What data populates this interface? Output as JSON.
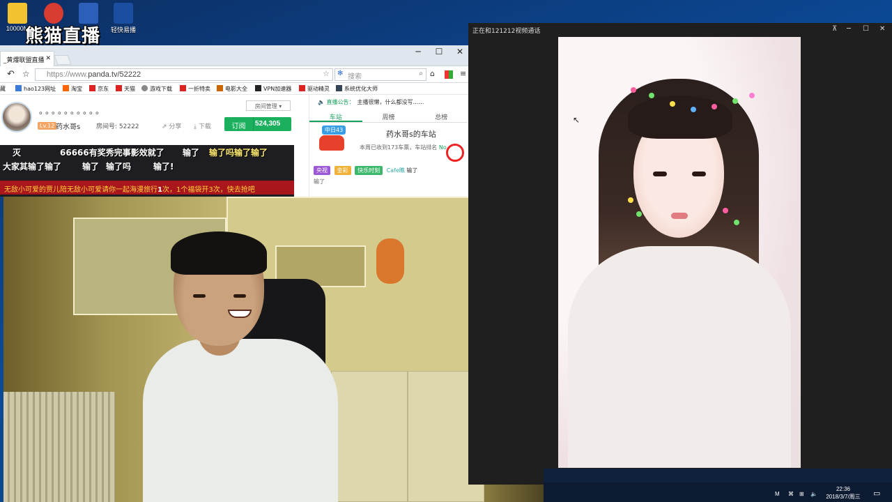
{
  "desktop": {
    "icons": [
      {
        "label": "10000M",
        "color": "#f2c230"
      },
      {
        "label": "",
        "color": "#d73b31"
      },
      {
        "label": "",
        "color": "#2b5fb8"
      },
      {
        "label": "轻快易播",
        "color": "#1b4da0"
      }
    ],
    "watermark": "熊猫直播"
  },
  "browser": {
    "tab_title": "_黄爆联盟直播",
    "url_prefix": "https://www.",
    "url_rest": "panda.tv/52222",
    "search_placeholder": "搜索",
    "controls": {
      "min": "─",
      "max": "☐",
      "close": "✕"
    },
    "bookmarks": [
      "藏",
      "hao123网址",
      "淘宝",
      "京东",
      "天猫",
      "游戏下载",
      "一折特卖",
      "电影大全",
      "VPN加速器",
      "驱动精灵",
      "系统优化大师"
    ],
    "room": {
      "dots": "。。。。。。。。。。",
      "level": "Lv.12",
      "host": "药水哥s",
      "popularity": "房间号: 52222",
      "share": "分享",
      "download": "下载",
      "manage": "房间管理",
      "subscribe": "订阅",
      "followers": "524,305"
    },
    "danmaku": [
      "66666有奖秀完事影效就了",
      "输了",
      "输了吗输了输了",
      "大家其输了输了",
      "输了",
      "输了吗",
      "输了!"
    ],
    "promo": {
      "text1": "无敌小可爱的贾儿陪",
      "text2": "无敌小可爱请你一起海漫旅行",
      "num": "1",
      "text3": "次，1个福袋开3次，快去抢吧"
    },
    "right_panel": {
      "notice_title": "直播公告：",
      "notice_text": "主播很懒，什么都没写……",
      "tabs": [
        "车站",
        "周榜",
        "总榜"
      ],
      "badge": "中日43",
      "station": "药水哥s的车站",
      "stat_text": "本周已收到173车票，车站排名",
      "stat_rank": "No. 108",
      "msg_tags": [
        "央视",
        "金彩",
        "快乐时刻"
      ],
      "msg_user": "Cafe瞧",
      "msg_text": "输了",
      "msg_more": "输了"
    }
  },
  "chat_window": {
    "title": "正在和121212视频通话",
    "controls": {
      "pin": "⊼",
      "min": "─",
      "max": "☐",
      "close": "✕"
    }
  },
  "taskbar": {
    "time": "22:36",
    "date": "2018/3/7/周三",
    "tray": [
      "M",
      "⌘",
      "⊞",
      "🔈"
    ]
  }
}
